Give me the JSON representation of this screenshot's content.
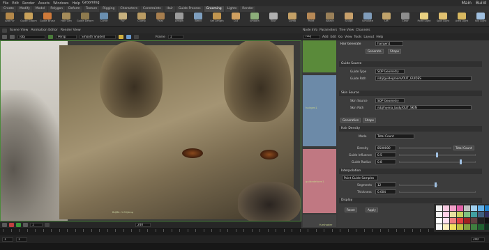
{
  "menubar": {
    "items": [
      "File",
      "Edit",
      "Render",
      "Assets",
      "Windows",
      "Help"
    ],
    "title": "Grooming",
    "right": [
      "Main",
      "Build"
    ]
  },
  "shelf_tabs": [
    "Create",
    "Modify",
    "Model",
    "Polygon",
    "Deform",
    "Texture",
    "Rigging",
    "Characters",
    "Constraints",
    "Hair",
    "Guide Process",
    "Grooming",
    "Lights",
    "Render"
  ],
  "tools": [
    {
      "label": "Add Fur",
      "color": "#b4884a"
    },
    {
      "label": "Guide Groom",
      "color": "#c9a15a"
    },
    {
      "label": "Guide Brush",
      "color": "#d07a3a"
    },
    {
      "label": "Hair Gen",
      "color": "#a58c5a"
    },
    {
      "label": "Guide Deform",
      "color": "#8e7a4e"
    },
    {
      "label": "Curve",
      "color": "#6a8fb0"
    },
    {
      "label": "Fur",
      "color": "#c6b07e"
    },
    {
      "label": "Clump",
      "color": "#b99b63"
    },
    {
      "label": "Frizz",
      "color": "#a77e4e"
    },
    {
      "label": "Length",
      "color": "#9c9c9c"
    },
    {
      "label": "Bend",
      "color": "#7e9fbf"
    },
    {
      "label": "Set Length",
      "color": "#c2964f"
    },
    {
      "label": "Cut",
      "color": "#d0a060"
    },
    {
      "label": "Smooth",
      "color": "#8cae7a"
    },
    {
      "label": "Blur",
      "color": "#b0b0b0"
    },
    {
      "label": "Comb",
      "color": "#c4a066"
    },
    {
      "label": "Paint",
      "color": "#b78956"
    },
    {
      "label": "Attach",
      "color": "#9a8058"
    },
    {
      "label": "Sculpt",
      "color": "#c8a06a"
    },
    {
      "label": "Simulate",
      "color": "#7f9cba"
    },
    {
      "label": "Lift",
      "color": "#bfa26b"
    },
    {
      "label": "Clear",
      "color": "#8e8e8e"
    },
    {
      "label": "Point Light",
      "color": "#e8d080"
    },
    {
      "label": "Spot Light",
      "color": "#e0c070"
    },
    {
      "label": "Area Light",
      "color": "#d8b860"
    },
    {
      "label": "Sky Light",
      "color": "#a0c0e0"
    },
    {
      "label": "Environment",
      "color": "#c0c0c0"
    }
  ],
  "left_header": {
    "tabs": [
      "Scene View",
      "Animation Editor",
      "Render View"
    ]
  },
  "left_toolbar": {
    "path": "/obj",
    "camera": "Persp",
    "shading": "Smooth Shaded",
    "frame_label": "Frame",
    "frame_value": "1"
  },
  "viewport": {
    "footer": "Bd/Bk: 1.00/dmp"
  },
  "playbar": {
    "frame": "1",
    "end": "240"
  },
  "timebar": {
    "start": "1",
    "current": "1",
    "end": "240"
  },
  "network": {
    "tabs": [
      "Node Info",
      "Parameters",
      "Tree View",
      "Channels"
    ],
    "path": "/obj",
    "toolbar": [
      "Add",
      "Edit",
      "Go",
      "View",
      "Tools",
      "Layout",
      "Help"
    ],
    "node_labels": [
      "hairgen1",
      "guidedeform1",
      "hairgen2",
      "furshader"
    ]
  },
  "params": {
    "title": "Hair Generate",
    "node_name": "hairgen1",
    "tab_a": "Generate",
    "tab_b": "Shape",
    "section_guides": "Guide Source",
    "guide_type_label": "Guide Type",
    "guide_type_value": "SOP Geometry",
    "guide_path_label": "Guide Path",
    "guide_path_value": "/obj/guidegroom/OUT_GUIDES",
    "section_skin": "Skin Source",
    "skin_type_label": "Skin Source",
    "skin_type_value": "SOP Geometry",
    "skin_path_label": "Skin Path",
    "skin_path_value": "/obj/hyena_body/OUT_SKIN",
    "tabs": [
      "Generation",
      "Shape"
    ],
    "section_density": "Hair Density",
    "density_mode_label": "Mode",
    "density_mode_value": "Total Count",
    "density_label": "Density",
    "density_value": "8500000",
    "influence_label": "Guide Influence",
    "influence_value": "0.5",
    "radius_label": "Guide Radius",
    "radius_value": "0.8",
    "section_interp": "Interpolation",
    "interp_value": "Point Guide Samples",
    "seg_label": "Segments",
    "seg_value": "12",
    "thick_label": "Thickness",
    "thick_value": "0.004",
    "section_display": "Display",
    "btn_reset": "Reset",
    "btn_apply": "Apply"
  },
  "palette": [
    "#f0f0f0",
    "#f7c9e0",
    "#f0a0c8",
    "#e060a8",
    "#c0c0c0",
    "#a0d0f0",
    "#60b0e8",
    "#2080c8",
    "#f4f4f4",
    "#ffd0e8",
    "#e8e0a0",
    "#c8d060",
    "#80c080",
    "#40a0a0",
    "#406080",
    "#303060",
    "#ffffff",
    "#ffe0f0",
    "#f08080",
    "#e04040",
    "#a02020",
    "#604040",
    "#202020",
    "#101010",
    "#f8f8f8",
    "#fff0c0",
    "#f0e060",
    "#c0c040",
    "#80a040",
    "#408040",
    "#206030",
    "#103020"
  ]
}
